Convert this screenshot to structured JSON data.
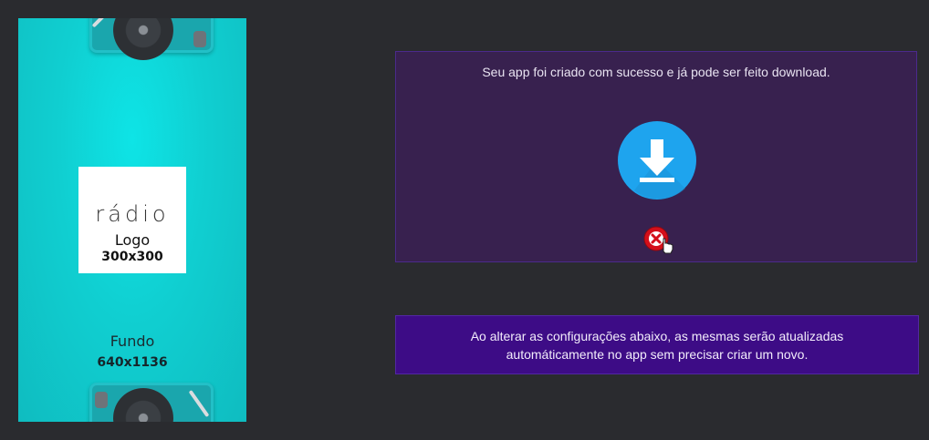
{
  "preview": {
    "logo_brand": "rádio",
    "logo_label": "Logo",
    "logo_size": "300x300",
    "background_label": "Fundo",
    "background_size": "640x1136",
    "background_color": "#10cfd1"
  },
  "success_panel": {
    "message": "Seu app foi criado com sucesso e já pode ser feito download.",
    "download_icon": "download-icon",
    "close_icon": "close-icon",
    "accent": "#1ea4ee"
  },
  "info_panel": {
    "message": "Ao alterar as configurações abaixo, as mesmas serão atualizadas automáticamente no app sem precisar criar um novo."
  }
}
